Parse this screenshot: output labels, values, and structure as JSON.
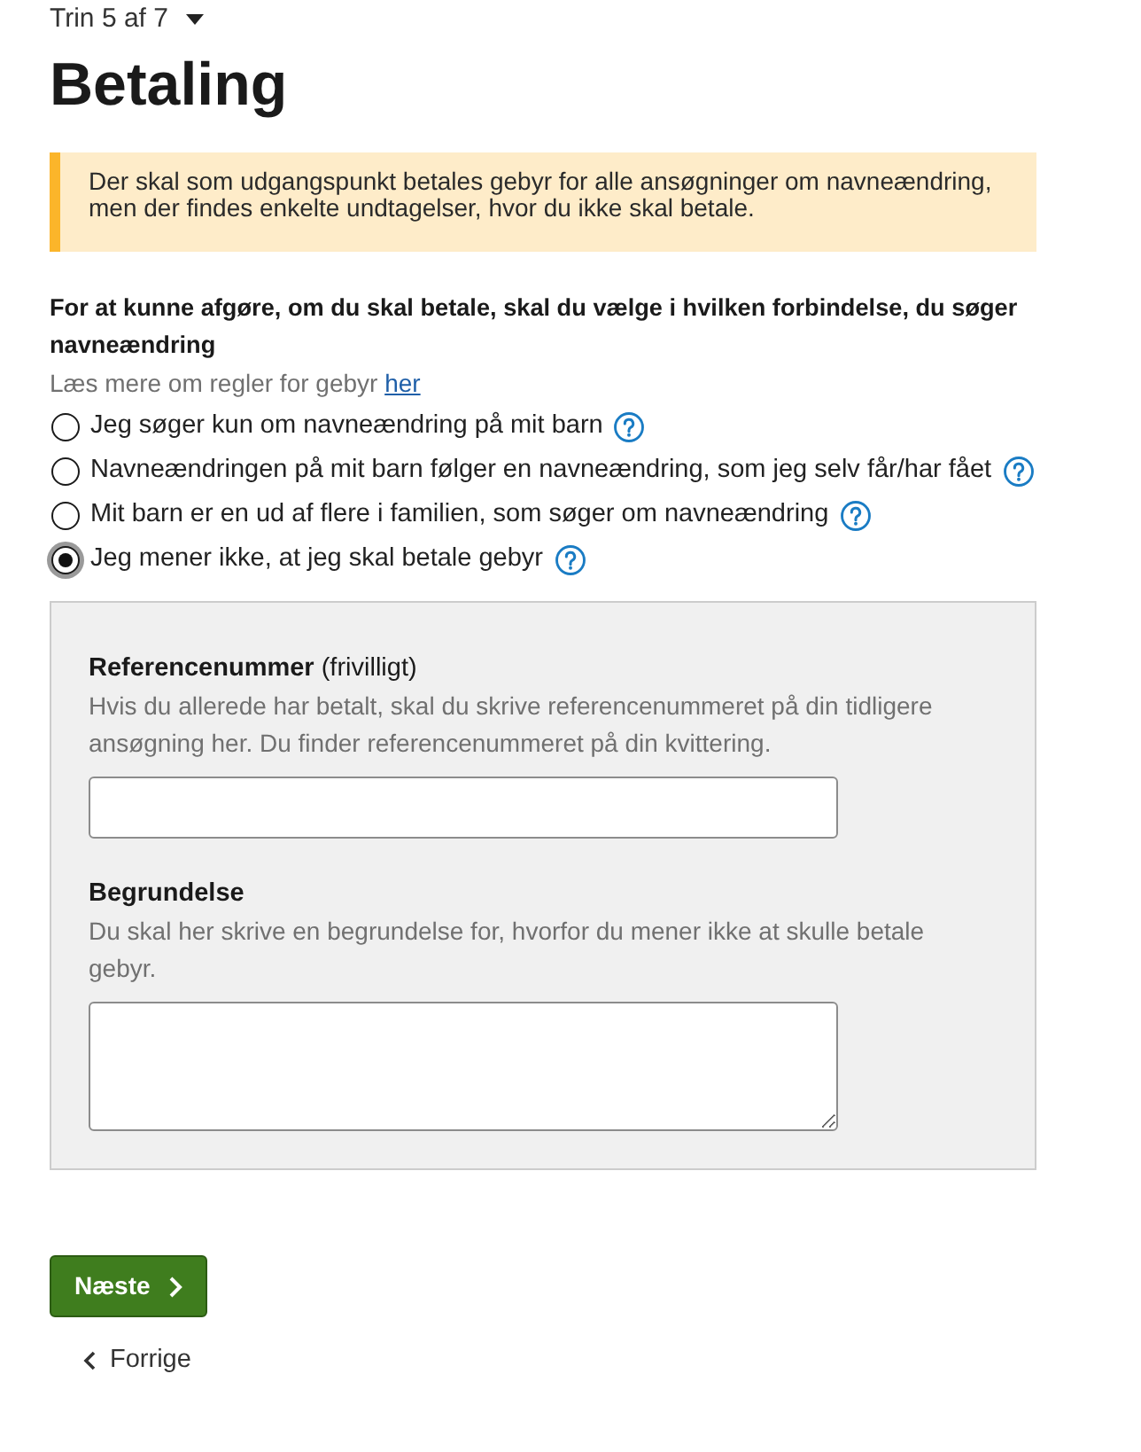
{
  "step_selector": {
    "label": "Trin 5 af 7"
  },
  "heading": "Betaling",
  "notice": {
    "text": "Der skal som udgangspunkt betales gebyr for alle ansøgninger om navneændring, men der findes enkelte undtagelser, hvor du ikke skal betale."
  },
  "question": {
    "label": "For at kunne afgøre, om du skal betale, skal du vælge i hvilken forbindelse, du søger navneændring",
    "hint": "Læs mere om regler for gebyr",
    "link": "her"
  },
  "options": [
    {
      "label": "Jeg søger kun om navneændring på mit barn",
      "selected": false
    },
    {
      "label": "Navneændringen på mit barn følger en navneændring, som jeg selv får/har fået",
      "selected": false
    },
    {
      "label": "Mit barn er en ud af flere i familien, som søger om navneændring",
      "selected": false
    },
    {
      "label": "Jeg mener ikke, at jeg skal betale gebyr",
      "selected": true
    }
  ],
  "panel": {
    "fields": [
      {
        "kind": "input",
        "label": "**Referencenummer** (frivilligt)",
        "description": "Hvis du allerede har betalt, skal du skrive referencenummeret på din tidligere ansøgning her. Du finder referencenummeret på din kvittering."
      },
      {
        "kind": "textarea",
        "label": "**Begrundelse**",
        "description": "Du skal her skrive en begrundelse for, hvorfor du mener ikke at skulle betale gebyr."
      }
    ]
  },
  "buttons": {
    "next": "Næste",
    "previous": "Forrige"
  }
}
